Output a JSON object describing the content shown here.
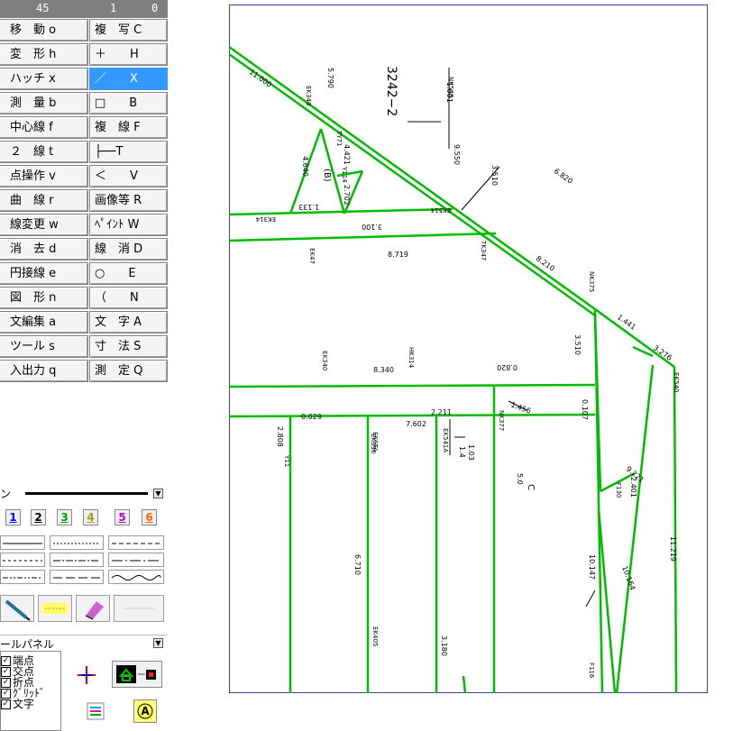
{
  "top_strip": {
    "values": [
      "45",
      "1",
      "0"
    ]
  },
  "commands": [
    {
      "left": "移　動 o",
      "right": "複　写 C"
    },
    {
      "left": "変　形 h",
      "right": "＋　　H"
    },
    {
      "left": "ハッチ x",
      "right": "／　　X",
      "right_active": true
    },
    {
      "left": "測　量 b",
      "right": "□　　B"
    },
    {
      "left": "中心線 f",
      "right": "複　線 F"
    },
    {
      "left": "２　線 t",
      "right": "├──T"
    },
    {
      "left": "点操作 v",
      "right": "＜　　V"
    },
    {
      "left": "曲　線 r",
      "right": "画像等 R"
    },
    {
      "left": "線変更 w",
      "right": "ﾍﾟｲﾝﾄ W"
    },
    {
      "left": "消　去 d",
      "right": "線　消 D"
    },
    {
      "left": "円接線 e",
      "right": "○　　E"
    },
    {
      "left": "図　形 n",
      "right": "（　　N"
    },
    {
      "left": "文編集 a",
      "right": "文　字 A"
    },
    {
      "left": "ツール s",
      "right": "寸　法 S"
    },
    {
      "left": "入出力 q",
      "right": "測　定 Q"
    }
  ],
  "pen_label": "ン",
  "color_buttons": [
    "1",
    "2",
    "3",
    "4",
    "5",
    "6"
  ],
  "colors": {
    "accent": "#3399ff",
    "drawing_line": "#00bb00",
    "frame": "#000080",
    "pen": [
      "#0000ff",
      "#000000",
      "#00a000",
      "#a0a000",
      "#c000c0",
      "#ff6000"
    ]
  },
  "tool_panel_title": "ールパネル",
  "snap_options": [
    "端点",
    "交点",
    "折点",
    "ｸﾞﾘｯﾄﾞ",
    "文字"
  ],
  "drawing": {
    "title_label": "3242−2",
    "texts": [
      "11.000",
      "6.820",
      "8.210",
      "1.441",
      "3.276",
      "3.510",
      "0.107",
      "1.456",
      "7.602",
      "2.808",
      "0.029",
      "8.340",
      "5.790",
      "8.719",
      "3.100",
      "9.550",
      "4.640",
      "4.421",
      "2.702",
      "1.133",
      "0.820",
      "1.001",
      "3.510",
      "6.710",
      "11.219",
      "10.164",
      "10.147",
      "9.221",
      "2.401",
      "3.180",
      "1.4",
      "1.03",
      "2.211",
      "5.0"
    ],
    "codes": [
      "EK340",
      "HK314",
      "EK514",
      "EK541A",
      "EK314",
      "NK548",
      "TK347",
      "NK375",
      "EK356",
      "TY71",
      "EK348",
      "Y114",
      "EK405",
      "NK377",
      "EK540",
      "EK6TA",
      "F116",
      "F130",
      "EK47",
      "Y11"
    ],
    "marks": [
      "(B)",
      "C"
    ]
  }
}
